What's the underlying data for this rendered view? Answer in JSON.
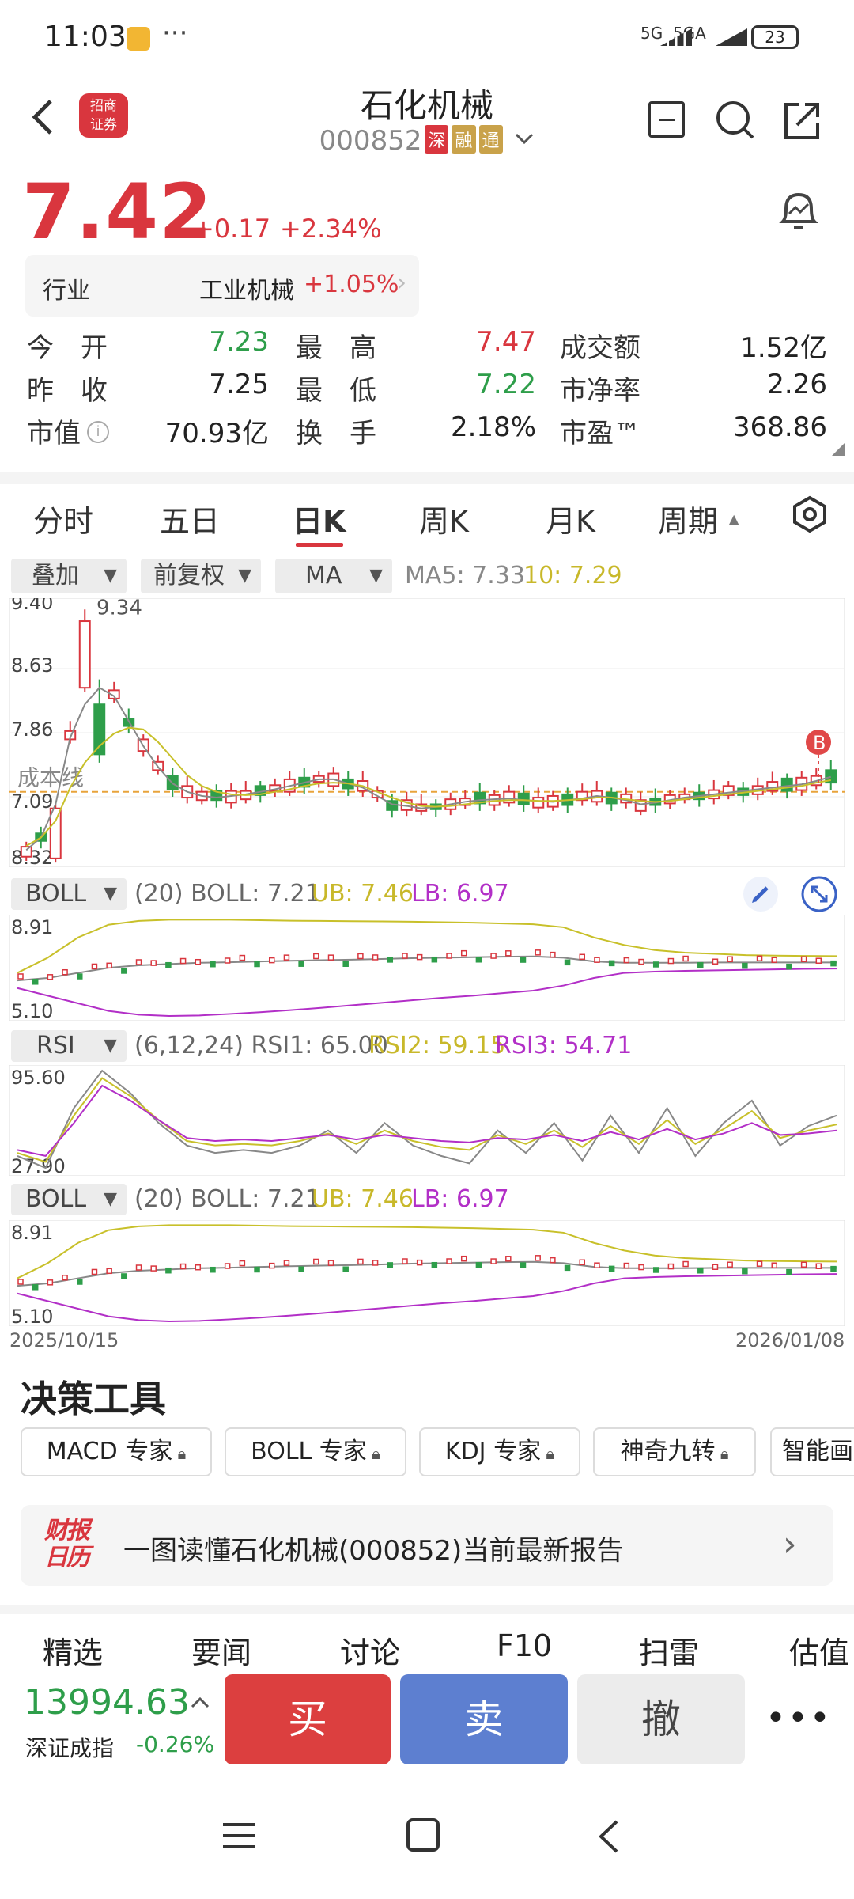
{
  "status_bar": {
    "time": "11:03",
    "network": "5G  5GA",
    "battery": "23"
  },
  "header": {
    "stock_name": "石化机械",
    "stock_code": "000852",
    "tags": [
      "深",
      "融",
      "通"
    ],
    "broker_logo": "招商证券"
  },
  "quote": {
    "price": "7.42",
    "change": "+0.17",
    "change_pct": "+2.34%",
    "industry_label": "行业",
    "industry_name": "工业机械",
    "industry_change": "+1.05%",
    "rows": [
      [
        {
          "l": "今　开",
          "v": "7.23",
          "c": "green"
        },
        {
          "l": "最　高",
          "v": "7.47",
          "c": "red"
        },
        {
          "l": "成交额",
          "v": "1.52亿",
          "c": "dark"
        }
      ],
      [
        {
          "l": "昨　收",
          "v": "7.25",
          "c": "dark"
        },
        {
          "l": "最　低",
          "v": "7.22",
          "c": "green"
        },
        {
          "l": "市净率",
          "v": "2.26",
          "c": "dark"
        }
      ],
      [
        {
          "l": "市值",
          "v": "70.93亿",
          "c": "dark"
        },
        {
          "l": "换　手",
          "v": "2.18%",
          "c": "dark"
        },
        {
          "l": "市盈™",
          "v": "368.86",
          "c": "dark"
        }
      ]
    ]
  },
  "period_tabs": [
    "分时",
    "五日",
    "日K",
    "周K",
    "月K",
    "周期"
  ],
  "period_active": "日K",
  "chart_controls": {
    "overlay": "叠加",
    "adjust": "前复权",
    "indicator": "MA"
  },
  "ma_legend": {
    "ma5": "MA5: 7.33",
    "ma10": "10: 7.29"
  },
  "indicator_panels": {
    "boll_name": "BOLL",
    "boll_params": "(20) BOLL: 7.21",
    "boll_ub": "UB: 7.46",
    "boll_lb": "LB: 6.97",
    "rsi_name": "RSI",
    "rsi_params": "(6,12,24) RSI1: 65.00",
    "rsi2": "RSI2: 59.15",
    "rsi3": "RSI3: 54.71"
  },
  "colors": {
    "up": "#d9363e",
    "down": "#2e9e4a",
    "ma5": "#888888",
    "ma10": "#c8c02a",
    "ub": "#c8c02a",
    "lb": "#b22fc7",
    "mid": "#888888",
    "sell": "#5d7fd0"
  },
  "chart_data": [
    {
      "type": "candlestick",
      "y_ticks": [
        "9.40",
        "8.63",
        "7.86",
        "7.09",
        "8.32"
      ],
      "ylim": [
        6.32,
        9.4
      ],
      "annotations": [
        "9.34",
        "成本线",
        "B"
      ],
      "x_start": "2025/10/15",
      "x_end": "2026/01/08",
      "series": [
        {
          "name": "MA5",
          "values": [
            6.45,
            6.6,
            7.0,
            7.8,
            8.2,
            8.4,
            8.3,
            8.0,
            7.7,
            7.45,
            7.25,
            7.15,
            7.1,
            7.08,
            7.1,
            7.12,
            7.15,
            7.18,
            7.22,
            7.26,
            7.3,
            7.3,
            7.25,
            7.2,
            7.1,
            7.0,
            6.98,
            6.95,
            6.97,
            7.0,
            7.03,
            7.05,
            7.06,
            7.07,
            7.05,
            7.04,
            7.03,
            7.05,
            7.07,
            7.1,
            7.08,
            7.05,
            7.0,
            7.02,
            7.05,
            7.08,
            7.1,
            7.12,
            7.14,
            7.16,
            7.18,
            7.2,
            7.22,
            7.24,
            7.28,
            7.33
          ]
        },
        {
          "name": "10",
          "values": [
            6.5,
            6.6,
            6.8,
            7.2,
            7.5,
            7.7,
            7.85,
            7.92,
            7.9,
            7.75,
            7.55,
            7.35,
            7.22,
            7.15,
            7.12,
            7.11,
            7.12,
            7.15,
            7.18,
            7.22,
            7.25,
            7.26,
            7.25,
            7.22,
            7.15,
            7.08,
            7.02,
            6.98,
            6.97,
            6.98,
            7.0,
            7.02,
            7.04,
            7.05,
            7.05,
            7.04,
            7.04,
            7.05,
            7.06,
            7.08,
            7.08,
            7.06,
            7.04,
            7.03,
            7.04,
            7.06,
            7.08,
            7.1,
            7.12,
            7.14,
            7.16,
            7.18,
            7.2,
            7.22,
            7.26,
            7.29
          ]
        }
      ]
    },
    {
      "type": "line",
      "name": "BOLL",
      "y_ticks": [
        "8.91",
        "5.10"
      ],
      "ylim": [
        5.1,
        8.91
      ],
      "series": [
        {
          "name": "UB",
          "values": [
            6.8,
            7.4,
            8.2,
            8.7,
            8.85,
            8.9,
            8.9,
            8.9,
            8.88,
            8.86,
            8.85,
            8.84,
            8.83,
            8.82,
            8.8,
            8.78,
            8.75,
            8.72,
            8.6,
            8.2,
            7.9,
            7.7,
            7.6,
            7.55,
            7.5,
            7.48,
            7.47,
            7.46
          ]
        },
        {
          "name": "BOLL",
          "values": [
            6.5,
            6.6,
            6.8,
            7.0,
            7.1,
            7.15,
            7.2,
            7.22,
            7.25,
            7.28,
            7.3,
            7.32,
            7.35,
            7.38,
            7.4,
            7.42,
            7.44,
            7.45,
            7.4,
            7.25,
            7.2,
            7.2,
            7.2,
            7.21,
            7.21,
            7.21,
            7.21,
            7.21
          ]
        },
        {
          "name": "LB",
          "values": [
            6.2,
            5.9,
            5.6,
            5.3,
            5.15,
            5.1,
            5.12,
            5.18,
            5.25,
            5.33,
            5.42,
            5.52,
            5.62,
            5.72,
            5.82,
            5.9,
            6.0,
            6.1,
            6.3,
            6.6,
            6.8,
            6.85,
            6.88,
            6.9,
            6.92,
            6.94,
            6.96,
            6.97
          ]
        }
      ]
    },
    {
      "type": "line",
      "name": "RSI",
      "y_ticks": [
        "95.60",
        "27.90"
      ],
      "ylim": [
        27.9,
        95.6
      ],
      "series": [
        {
          "name": "RSI1",
          "values": [
            38,
            30,
            70,
            95,
            80,
            60,
            45,
            40,
            42,
            40,
            45,
            55,
            40,
            60,
            45,
            38,
            33,
            55,
            40,
            60,
            35,
            65,
            40,
            70,
            38,
            60,
            75,
            45,
            58,
            65
          ]
        },
        {
          "name": "RSI2",
          "values": [
            40,
            34,
            65,
            90,
            78,
            62,
            48,
            45,
            46,
            45,
            48,
            53,
            46,
            55,
            48,
            44,
            42,
            52,
            46,
            55,
            44,
            58,
            46,
            62,
            46,
            56,
            68,
            50,
            55,
            59
          ]
        },
        {
          "name": "RSI3",
          "values": [
            42,
            38,
            60,
            85,
            75,
            62,
            50,
            48,
            49,
            48,
            50,
            52,
            49,
            52,
            50,
            48,
            47,
            50,
            49,
            52,
            48,
            54,
            49,
            56,
            49,
            53,
            60,
            52,
            53,
            55
          ]
        }
      ]
    }
  ],
  "date_range": {
    "start": "2025/10/15",
    "end": "2026/01/08"
  },
  "tools": {
    "title": "决策工具",
    "items": [
      "MACD 专家",
      "BOLL 专家",
      "KDJ 专家",
      "神奇九转",
      "智能画"
    ]
  },
  "report_banner": {
    "logo": "财报日历",
    "text": "一图读懂石化机械(000852)当前最新报告"
  },
  "bottom_tabs": [
    "精选",
    "要闻",
    "讨论",
    "F10",
    "扫雷",
    "估值"
  ],
  "index": {
    "value": "13994.63",
    "name": "深证成指",
    "change": "-0.26%"
  },
  "actions": {
    "buy": "买",
    "sell": "卖",
    "cancel": "撤"
  }
}
